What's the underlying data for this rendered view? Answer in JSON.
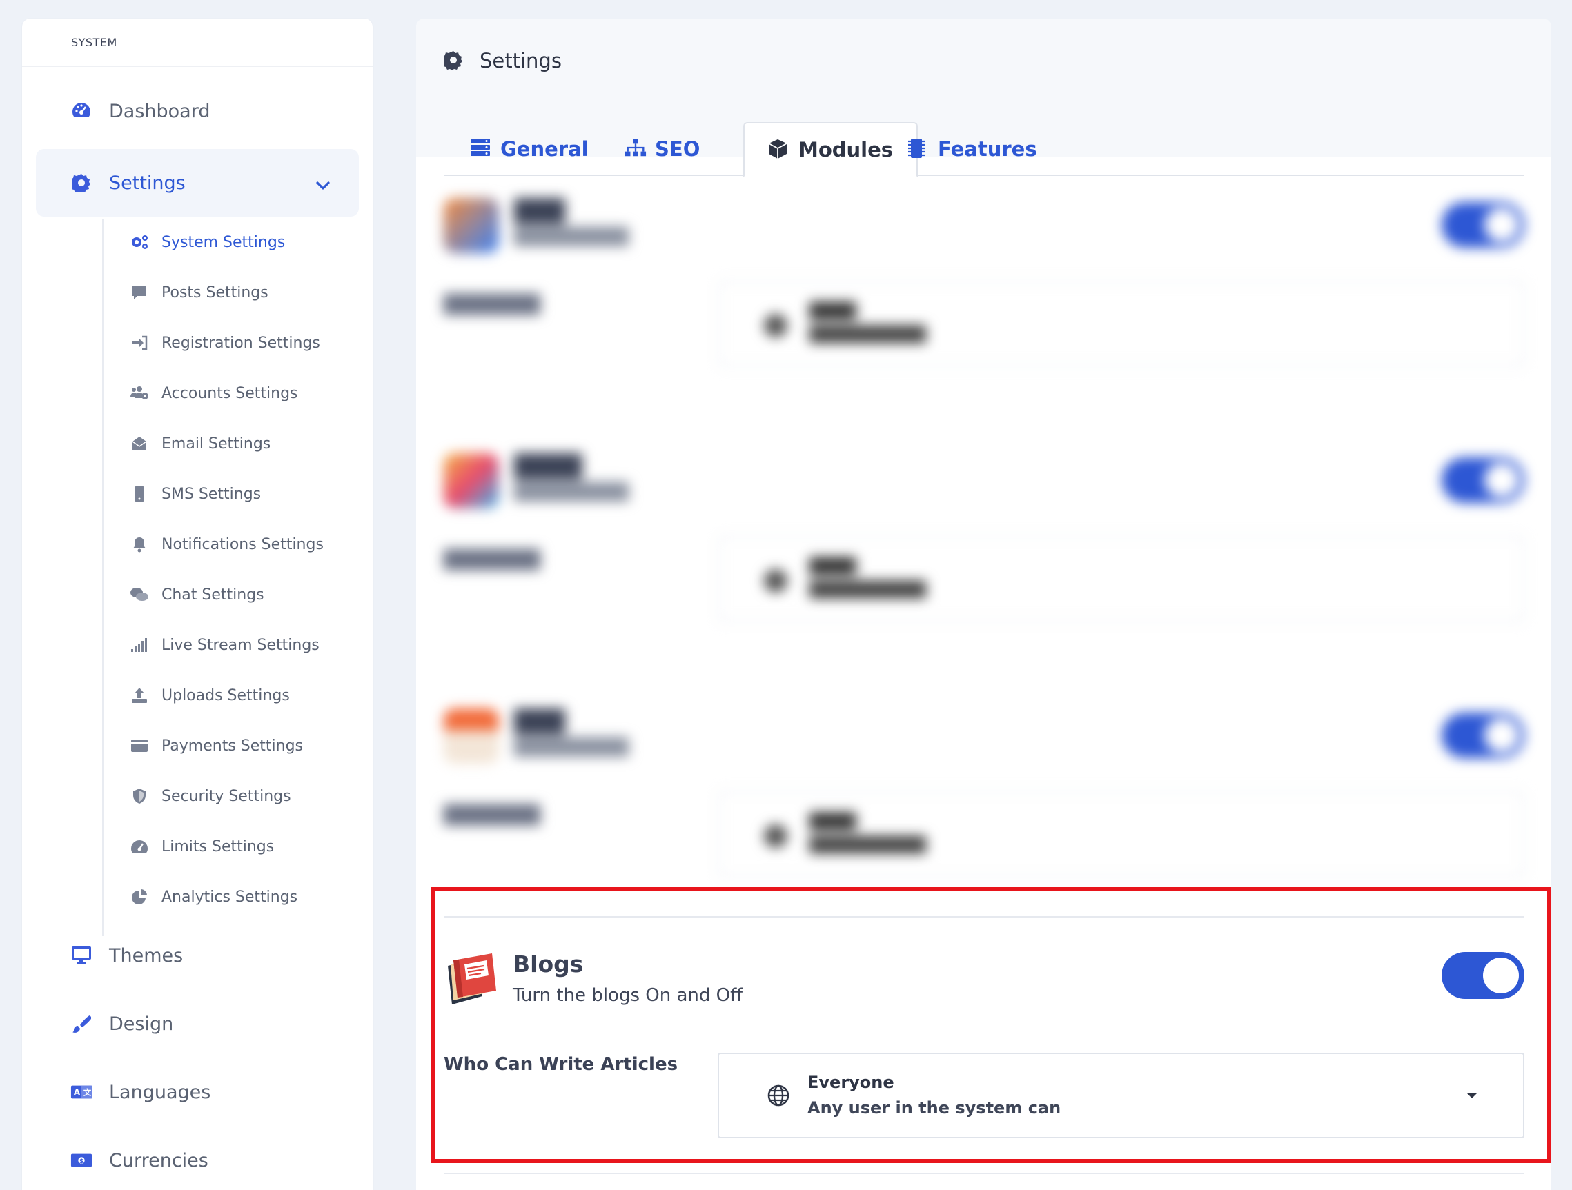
{
  "sidebar": {
    "section_label": "SYSTEM",
    "nav": [
      {
        "label": "Dashboard",
        "icon": "dashboard-gauge-icon"
      },
      {
        "label": "Settings",
        "icon": "gear-icon"
      },
      {
        "label": "Themes",
        "icon": "monitor-icon"
      },
      {
        "label": "Design",
        "icon": "paintbrush-icon"
      },
      {
        "label": "Languages",
        "icon": "language-icon"
      },
      {
        "label": "Currencies",
        "icon": "money-bill-icon"
      }
    ],
    "settings_sub": [
      {
        "label": "System Settings",
        "icon": "cogs-icon"
      },
      {
        "label": "Posts Settings",
        "icon": "comment-icon"
      },
      {
        "label": "Registration Settings",
        "icon": "sign-in-icon"
      },
      {
        "label": "Accounts Settings",
        "icon": "users-cog-icon"
      },
      {
        "label": "Email Settings",
        "icon": "envelope-open-icon"
      },
      {
        "label": "SMS Settings",
        "icon": "mobile-icon"
      },
      {
        "label": "Notifications Settings",
        "icon": "bell-icon"
      },
      {
        "label": "Chat Settings",
        "icon": "comments-icon"
      },
      {
        "label": "Live Stream Settings",
        "icon": "signal-icon"
      },
      {
        "label": "Uploads Settings",
        "icon": "upload-icon"
      },
      {
        "label": "Payments Settings",
        "icon": "credit-card-icon"
      },
      {
        "label": "Security Settings",
        "icon": "shield-icon"
      },
      {
        "label": "Limits Settings",
        "icon": "gauge-icon"
      },
      {
        "label": "Analytics Settings",
        "icon": "pie-chart-icon"
      }
    ]
  },
  "page": {
    "title": "Settings",
    "tabs": [
      {
        "label": "General",
        "icon": "server-icon"
      },
      {
        "label": "SEO",
        "icon": "sitemap-icon"
      },
      {
        "label": "Modules",
        "icon": "cube-icon"
      },
      {
        "label": "Features",
        "icon": "microchip-icon"
      }
    ],
    "active_tab": "Modules"
  },
  "blogs": {
    "title": "Blogs",
    "description": "Turn the blogs On and Off",
    "enabled": true,
    "writers_label": "Who Can Write Articles",
    "writers_select": {
      "value_title": "Everyone",
      "value_desc": "Any user in the system can"
    }
  },
  "colors": {
    "accent": "#2d57d4",
    "highlight": "#e8151c",
    "background": "#eef2f8"
  }
}
